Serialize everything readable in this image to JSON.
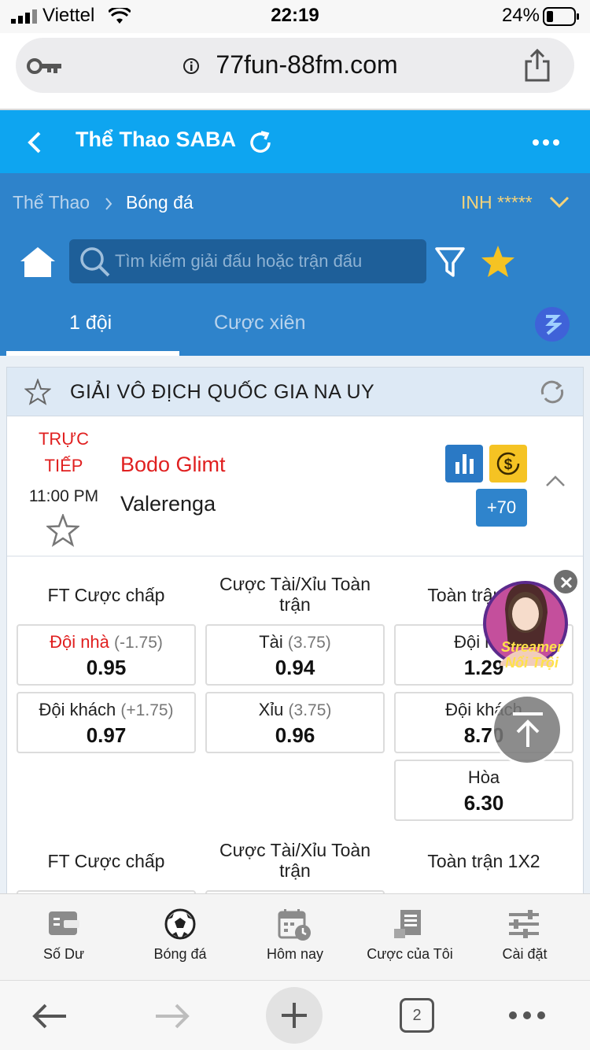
{
  "status_bar": {
    "carrier": "Viettel",
    "time": "22:19",
    "battery": "24%"
  },
  "browser": {
    "url": "77fun-88fm.com",
    "tab_count": "2"
  },
  "app_header": {
    "title": "Thể Thao SABA"
  },
  "breadcrumb": {
    "root": "Thể Thao",
    "current": "Bóng đá"
  },
  "account": {
    "username": "INH *****"
  },
  "search": {
    "placeholder": "Tìm kiếm giải đấu hoặc trận đấu"
  },
  "tabs": [
    {
      "label": "1 đội",
      "active": true
    },
    {
      "label": "Cược xiên",
      "active": false
    }
  ],
  "league": {
    "name": "GIẢI VÔ ĐỊCH QUỐC GIA NA UY",
    "match": {
      "status_line1": "TRỰC",
      "status_line2": "TIẾP",
      "time": "11:00 PM",
      "home_team": "Bodo Glimt",
      "away_team": "Valerenga",
      "more_bets": "+70"
    },
    "markets": {
      "handicap": {
        "header": "FT Cược chấp",
        "home": {
          "label": "Đội nhà",
          "line": "(-1.75)",
          "odds": "0.95"
        },
        "away": {
          "label": "Đội khách",
          "line": "(+1.75)",
          "odds": "0.97"
        }
      },
      "over_under": {
        "header_line1": "Cược Tài/Xỉu Toàn",
        "header_line2": "trận",
        "over": {
          "label": "Tài",
          "line": "(3.75)",
          "odds": "0.94"
        },
        "under": {
          "label": "Xỉu",
          "line": "(3.75)",
          "odds": "0.96"
        }
      },
      "one_x_two": {
        "header": "Toàn trận 1X2",
        "home": {
          "label": "Đội nhà",
          "odds": "1.29"
        },
        "away": {
          "label": "Đội khách",
          "odds": "8.70"
        },
        "draw": {
          "label": "Hòa",
          "odds": "6.30"
        }
      }
    },
    "next_row_headers": {
      "handicap": "FT Cược chấp",
      "over_under_line1": "Cược Tài/Xỉu Toàn",
      "over_under_line2": "trận",
      "one_x_two": "Toàn trận 1X2"
    }
  },
  "streamer_ad": {
    "line1": "Streamer",
    "line2": "Nổi Trội"
  },
  "bottom_nav": [
    {
      "label": "Số Dư",
      "icon": "wallet-icon"
    },
    {
      "label": "Bóng đá",
      "icon": "soccer-ball-icon"
    },
    {
      "label": "Hôm nay",
      "icon": "calendar-clock-icon"
    },
    {
      "label": "Cược của Tôi",
      "icon": "bet-slip-icon"
    },
    {
      "label": "Cài đặt",
      "icon": "sliders-icon"
    }
  ],
  "colors": {
    "app_header": "#0ea5f0",
    "sub_header": "#2e83cb",
    "live_red": "#e02020",
    "account_gold": "#f5d37a",
    "star_gold": "#f5c323"
  }
}
